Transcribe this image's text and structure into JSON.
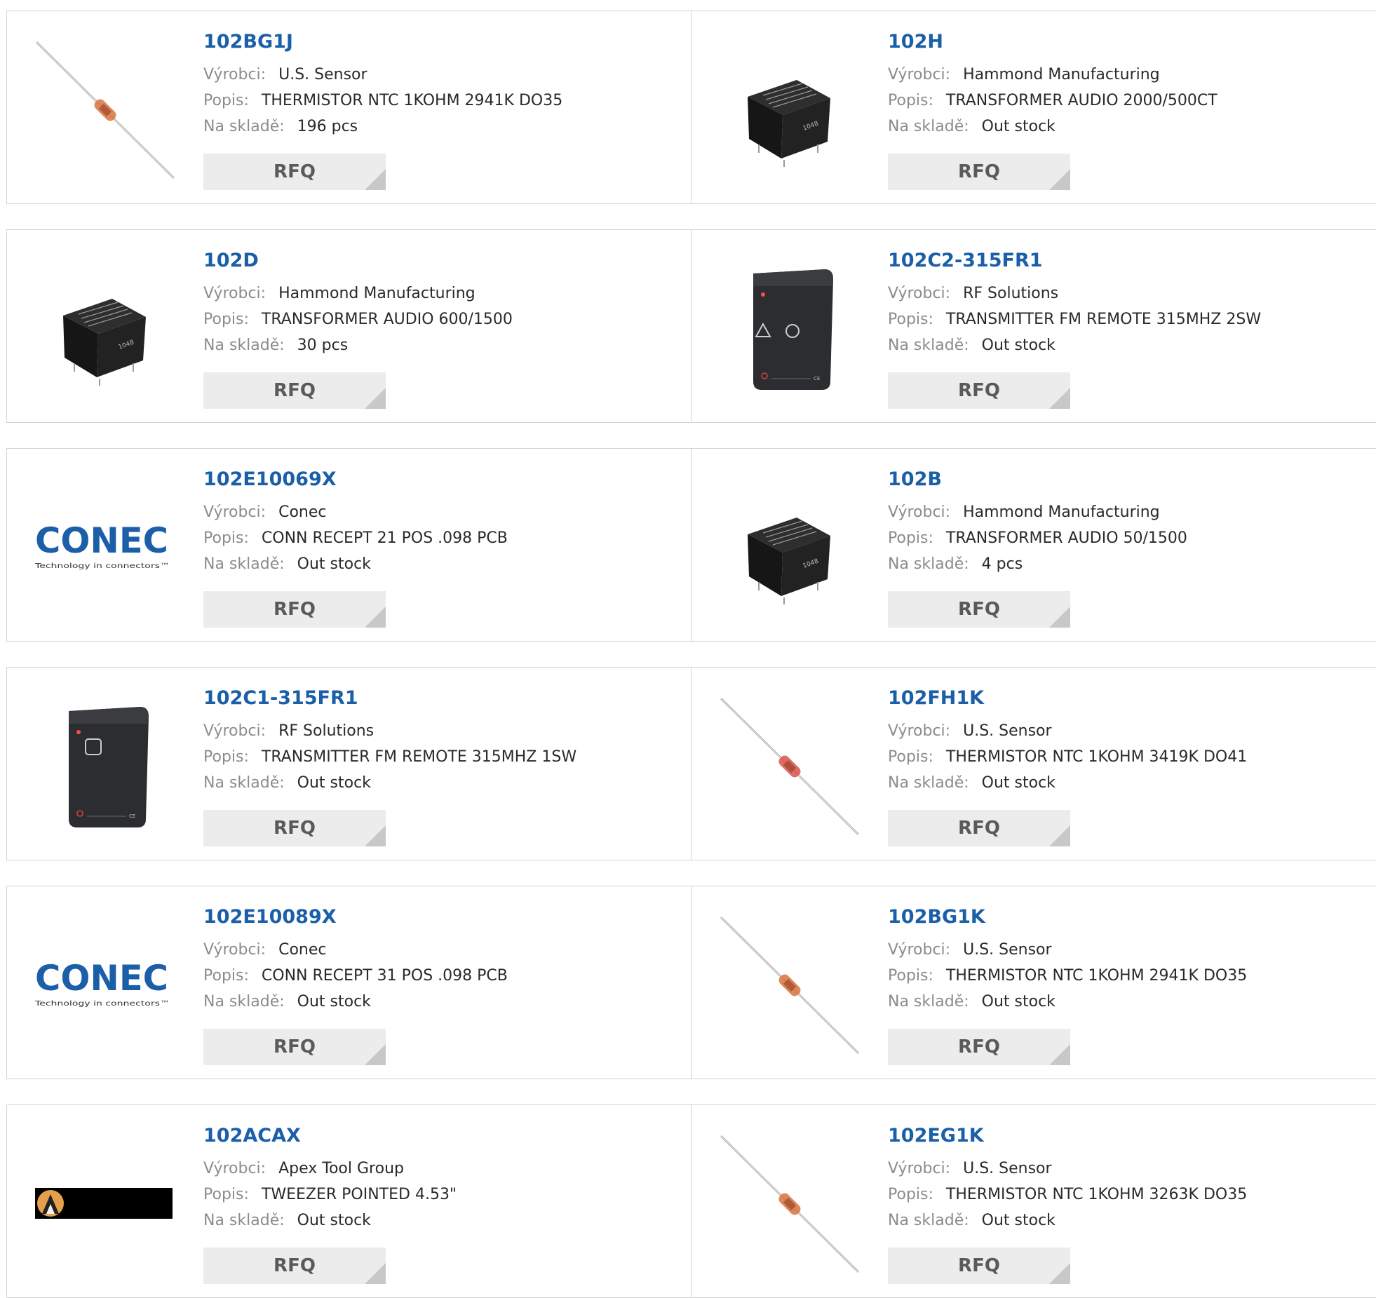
{
  "labels": {
    "manufacturer": "Výrobci:",
    "description": "Popis:",
    "stock": "Na skladě:",
    "rfq": "RFQ"
  },
  "colors": {
    "part_number": "#1a5fa8",
    "label": "#8c8c8c",
    "button_bg": "#ececec",
    "button_text": "#5a5a5a"
  },
  "products": [
    {
      "part": "102BG1J",
      "manufacturer": "U.S. Sensor",
      "description": "THERMISTOR NTC 1KOHM 2941K DO35",
      "stock": "196 pcs",
      "image": "thermistor-orange"
    },
    {
      "part": "102H",
      "manufacturer": "Hammond Manufacturing",
      "description": "TRANSFORMER AUDIO 2000/500CT",
      "stock": "Out stock",
      "image": "transformer"
    },
    {
      "part": "102D",
      "manufacturer": "Hammond Manufacturing",
      "description": "TRANSFORMER AUDIO 600/1500",
      "stock": "30 pcs",
      "image": "transformer"
    },
    {
      "part": "102C2-315FR1",
      "manufacturer": "RF Solutions",
      "description": "TRANSMITTER FM REMOTE 315MHZ 2SW",
      "stock": "Out stock",
      "image": "remote-2btn"
    },
    {
      "part": "102E10069X",
      "manufacturer": "Conec",
      "description": "CONN RECEPT 21 POS .098 PCB",
      "stock": "Out stock",
      "image": "conec-logo"
    },
    {
      "part": "102B",
      "manufacturer": "Hammond Manufacturing",
      "description": "TRANSFORMER AUDIO 50/1500",
      "stock": "4 pcs",
      "image": "transformer"
    },
    {
      "part": "102C1-315FR1",
      "manufacturer": "RF Solutions",
      "description": "TRANSMITTER FM REMOTE 315MHZ 1SW",
      "stock": "Out stock",
      "image": "remote-1btn"
    },
    {
      "part": "102FH1K",
      "manufacturer": "U.S. Sensor",
      "description": "THERMISTOR NTC 1KOHM 3419K DO41",
      "stock": "Out stock",
      "image": "thermistor-red"
    },
    {
      "part": "102E10089X",
      "manufacturer": "Conec",
      "description": "CONN RECEPT 31 POS .098 PCB",
      "stock": "Out stock",
      "image": "conec-logo"
    },
    {
      "part": "102BG1K",
      "manufacturer": "U.S. Sensor",
      "description": "THERMISTOR NTC 1KOHM 2941K DO35",
      "stock": "Out stock",
      "image": "thermistor-orange"
    },
    {
      "part": "102ACAX",
      "manufacturer": "Apex Tool Group",
      "description": "TWEEZER POINTED 4.53\"",
      "stock": "Out stock",
      "image": "apex-logo"
    },
    {
      "part": "102EG1K",
      "manufacturer": "U.S. Sensor",
      "description": "THERMISTOR NTC 1KOHM 3263K DO35",
      "stock": "Out stock",
      "image": "thermistor-orange"
    }
  ],
  "conec_logo": {
    "wordmark": "CONEC",
    "tagline": "Technology in connectors™"
  }
}
